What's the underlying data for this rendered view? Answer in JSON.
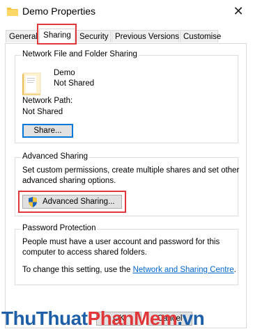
{
  "window": {
    "title": "Demo Properties",
    "close_glyph": "✕"
  },
  "tabs": [
    {
      "label": "General"
    },
    {
      "label": "Sharing"
    },
    {
      "label": "Security"
    },
    {
      "label": "Previous Versions"
    },
    {
      "label": "Customise"
    }
  ],
  "network_sharing": {
    "title": "Network File and Folder Sharing",
    "folder_name": "Demo",
    "folder_status": "Not Shared",
    "path_label": "Network Path:",
    "path_value": "Not Shared",
    "share_button": "Share..."
  },
  "advanced_sharing": {
    "title": "Advanced Sharing",
    "description_line1": "Set custom permissions, create multiple shares and set other",
    "description_line2": "advanced sharing options.",
    "button": "Advanced Sharing..."
  },
  "password_protection": {
    "title": "Password Protection",
    "line1": "People must have a user account and password for this",
    "line2": "computer to access shared folders.",
    "change_prefix": "To change this setting, use the",
    "link": "Network and Sharing Centre",
    "change_suffix": "."
  },
  "footer_buttons": {
    "ok": "OK",
    "cancel": "Cancel"
  },
  "watermark": {
    "part1": "ThuThuat",
    "part2": "PhanMem",
    "part3": ".vn"
  },
  "colors": {
    "highlight": "#e0383a",
    "link": "#0066cc",
    "focus": "#0078d7",
    "watermark_blue": "#1f5fa8",
    "watermark_red": "#e0383a"
  },
  "icons": {
    "title_icon": "folder-icon",
    "folder_icon": "folder-icon",
    "shield_icon": "uac-shield-icon"
  }
}
